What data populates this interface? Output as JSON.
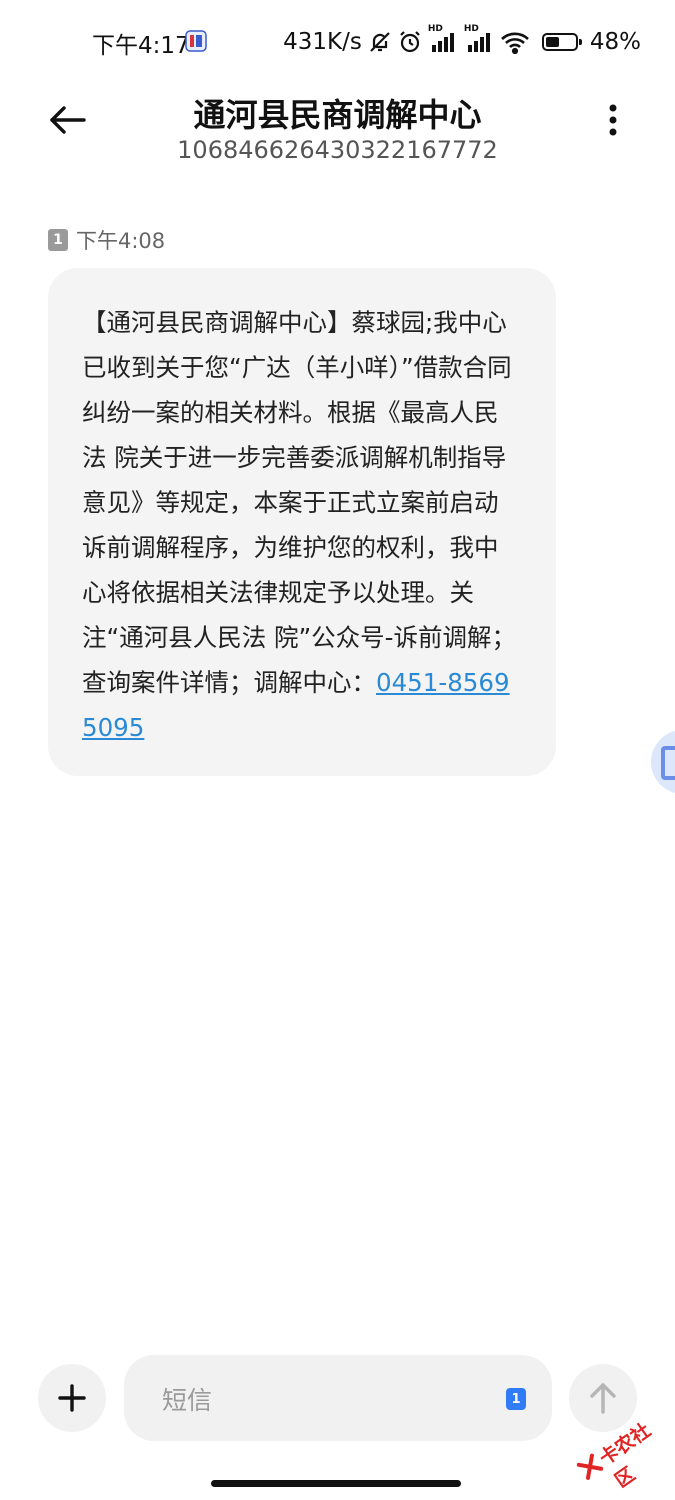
{
  "status_bar": {
    "time": "下午4:17",
    "net_speed": "431K/s",
    "signal_label_1": "HD",
    "signal_label_2": "HD",
    "battery_percent": "48%",
    "battery_level": 0.48
  },
  "header": {
    "title": "通河县民商调解中心",
    "number": "106846626430322167772"
  },
  "message": {
    "sim_slot": "1",
    "time": "下午4:08",
    "body": "【通河县民商调解中心】蔡球园;我中心已收到关于您“广达（羊小咩）”借款合同纠纷一案的相关材料。根据《最高人民法 院关于进一步完善委派调解机制指导意见》等规定，本案于正式立案前启动诉前调解程序，为维护您的权利，我中心将依据相关法律规定予以处理。关注“通河县人民法 院”公众号-诉前调解；查询案件详情；调解中心：",
    "phone": "0451-85695095"
  },
  "input": {
    "placeholder": "短信",
    "sim_slot": "1"
  },
  "watermark": {
    "text": "卡农社区"
  },
  "colors": {
    "link": "#2a8ad6",
    "bubble_bg": "#f4f4f4",
    "sim_blue": "#2f7cf6",
    "watermark_red": "#e02424"
  }
}
